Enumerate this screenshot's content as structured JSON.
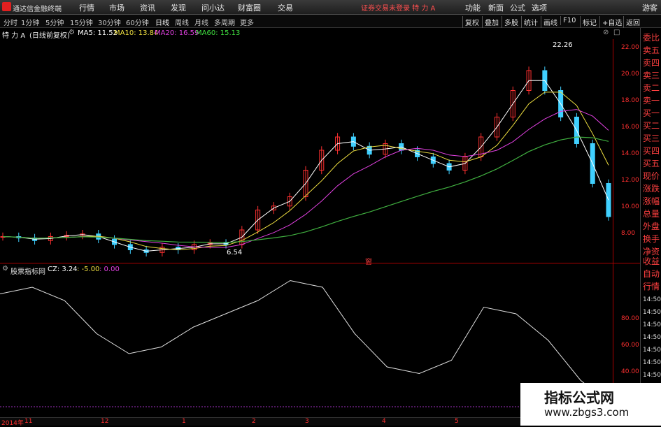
{
  "menubar": {
    "app_title": "通达信金融终端",
    "items": [
      "行情",
      "市场",
      "资讯",
      "发现",
      "问小达",
      "财富圈",
      "交易"
    ],
    "center_text": "证券交易未登录 特 力 A",
    "right_items": [
      "功能",
      "新面",
      "公式",
      "选项"
    ],
    "far_right": "游客"
  },
  "timeframes": [
    "分时",
    "1分钟",
    "5分钟",
    "15分钟",
    "30分钟",
    "60分钟",
    "日线",
    "周线",
    "月线",
    "多周期",
    "更多"
  ],
  "active_timeframe": "日线",
  "tools": [
    "复权",
    "叠加",
    "多股",
    "统计",
    "画线",
    "F10",
    "标记",
    "+自选",
    "返回"
  ],
  "indicator_row": {
    "stock": "特 力 A",
    "adj": "(日线前复权)",
    "ma": [
      {
        "label": "MA5: 11.52",
        "color": "#ffffff"
      },
      {
        "label": "MA10: 13.84",
        "color": "#f0e040"
      },
      {
        "label": "MA20: 16.59",
        "color": "#e040e0"
      },
      {
        "label": "MA60: 15.13",
        "color": "#40e040"
      }
    ]
  },
  "price_axis": [
    "22.00",
    "20.00",
    "18.00",
    "16.00",
    "14.00",
    "12.00",
    "10.00",
    "8.00"
  ],
  "annotations": {
    "high": "22.26",
    "low": "6.54",
    "mid_marker": "窗"
  },
  "sub_indicator": {
    "name": "股票指标网",
    "cz": "CZ: 3.24",
    "v2": ": -5.00",
    "v3": ": 0.00"
  },
  "sub_axis": [
    "80.00",
    "60.00",
    "40.00"
  ],
  "right_panel": [
    "委比",
    "卖五",
    "卖四",
    "卖三",
    "卖二",
    "卖一",
    "买一",
    "买二",
    "买三",
    "买四",
    "买五",
    "现价",
    "涨跌",
    "涨幅",
    "总量",
    "外盘",
    "换手",
    "净资",
    "收益",
    "自动",
    "行情"
  ],
  "times": [
    "14:50",
    "14:50",
    "14:50",
    "14:50",
    "14:50",
    "14:50",
    "14:50"
  ],
  "bottom_axis": [
    "2014年",
    "11",
    "12",
    "1",
    "2",
    "3",
    "4",
    "5"
  ],
  "watermark": {
    "title": "指标公式网",
    "url": "www.zbgs3.com"
  },
  "chart_data": {
    "type": "line",
    "closes": [
      8.0,
      7.9,
      7.7,
      8.0,
      8.1,
      8.2,
      7.8,
      7.4,
      7.0,
      6.8,
      7.2,
      7.0,
      7.4,
      7.5,
      7.4,
      8.5,
      10.0,
      10.3,
      11.0,
      13.0,
      14.5,
      15.5,
      14.8,
      14.2,
      15.0,
      14.5,
      14.0,
      13.5,
      13.0,
      14.0,
      15.5,
      17.0,
      19.0,
      20.5,
      19.0,
      17.0,
      15.0,
      12.0,
      9.5
    ],
    "cz": [
      85,
      90,
      80,
      55,
      40,
      45,
      60,
      70,
      80,
      95,
      90,
      55,
      30,
      25,
      35,
      75,
      70,
      50,
      20,
      0
    ]
  }
}
